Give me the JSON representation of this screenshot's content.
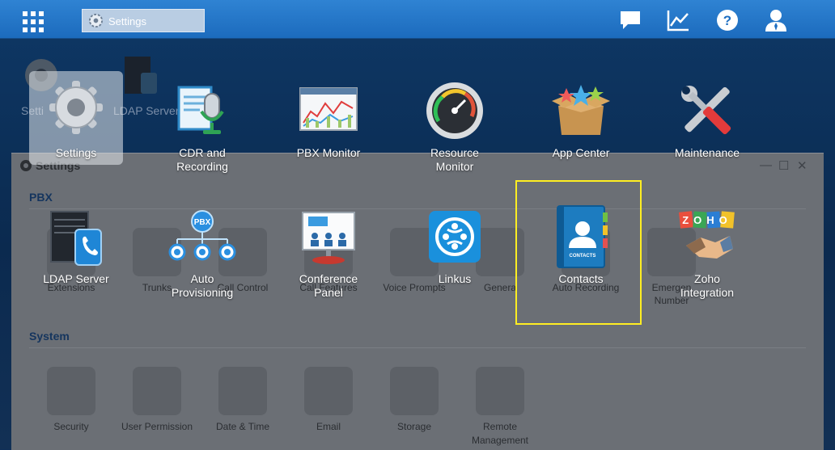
{
  "taskbar": {
    "menu_icon": "apps-grid-icon",
    "open_tab": "Settings",
    "icons": [
      "chat-icon",
      "chart-icon",
      "help-icon",
      "user-icon"
    ]
  },
  "desktop_bg": {
    "items": [
      "Setti",
      "LDAP Server"
    ]
  },
  "window": {
    "title": "Settings",
    "sections": [
      {
        "title": "PBX",
        "items": [
          "Extensions",
          "Trunks",
          "Call Control",
          "Call Features",
          "Voice Prompts",
          "Genera",
          "Auto Recording",
          "Emergen",
          "Number"
        ]
      },
      {
        "title": "System",
        "items": [
          "Security",
          "User Permission",
          "Date & Time",
          "Email",
          "Storage",
          "Remote",
          "Management"
        ]
      }
    ]
  },
  "launcher": {
    "row1": [
      {
        "label": "Settings",
        "icon": "gear-icon"
      },
      {
        "label": "CDR and",
        "label2": "Recording",
        "icon": "cdr-microphone-icon"
      },
      {
        "label": "PBX Monitor",
        "icon": "monitor-chart-icon"
      },
      {
        "label": "Resource",
        "label2": "Monitor",
        "icon": "gauge-icon"
      },
      {
        "label": "App Center",
        "icon": "box-stars-icon"
      },
      {
        "label": "Maintenance",
        "icon": "wrench-screwdriver-icon"
      }
    ],
    "row2": [
      {
        "label": "LDAP Server",
        "icon": "server-phone-icon"
      },
      {
        "label": "Auto",
        "label2": "Provisioning",
        "icon": "pbx-tree-icon",
        "badge": "PBX"
      },
      {
        "label": "Conference",
        "label2": "Panel",
        "icon": "presentation-board-icon"
      },
      {
        "label": "Linkus",
        "icon": "linkus-logo-icon"
      },
      {
        "label": "Contacts",
        "icon": "contacts-book-icon",
        "book_text": "CONTACTS"
      },
      {
        "label": "Zoho",
        "label2": "Integration",
        "icon": "zoho-handshake-icon",
        "logo_text": "ZOHO"
      }
    ]
  },
  "colors": {
    "taskbar": "#2a7bd0",
    "focus": "#ffee22",
    "section_title": "#15355e"
  }
}
